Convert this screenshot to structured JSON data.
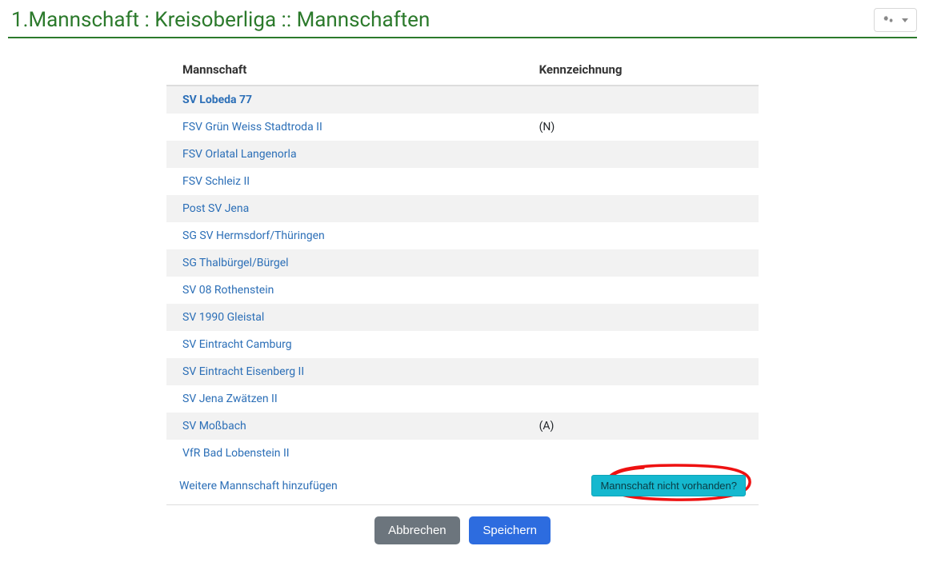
{
  "header": {
    "title": "1.Mannschaft : Kreisoberliga :: Mannschaften"
  },
  "table": {
    "columns": {
      "team": "Mannschaft",
      "mark": "Kennzeichnung"
    },
    "rows": [
      {
        "team": "SV Lobeda 77",
        "mark": "",
        "active": true
      },
      {
        "team": "FSV Grün Weiss Stadtroda II",
        "mark": "(N)",
        "active": false
      },
      {
        "team": "FSV Orlatal Langenorla",
        "mark": "",
        "active": false
      },
      {
        "team": "FSV Schleiz II",
        "mark": "",
        "active": false
      },
      {
        "team": "Post SV Jena",
        "mark": "",
        "active": false
      },
      {
        "team": "SG SV Hermsdorf/Thüringen",
        "mark": "",
        "active": false
      },
      {
        "team": "SG Thalbürgel/Bürgel",
        "mark": "",
        "active": false
      },
      {
        "team": "SV 08 Rothenstein",
        "mark": "",
        "active": false
      },
      {
        "team": "SV 1990 Gleistal",
        "mark": "",
        "active": false
      },
      {
        "team": "SV Eintracht Camburg",
        "mark": "",
        "active": false
      },
      {
        "team": "SV Eintracht Eisenberg II",
        "mark": "",
        "active": false
      },
      {
        "team": "SV Jena Zwätzen II",
        "mark": "",
        "active": false
      },
      {
        "team": "SV Moßbach",
        "mark": "(A)",
        "active": false
      },
      {
        "team": "VfR Bad Lobenstein II",
        "mark": "",
        "active": false
      }
    ]
  },
  "addRow": {
    "addLink": "Weitere Mannschaft hinzufügen",
    "missingBtn": "Mannschaft nicht vorhanden?"
  },
  "actions": {
    "cancel": "Abbrechen",
    "save": "Speichern"
  }
}
